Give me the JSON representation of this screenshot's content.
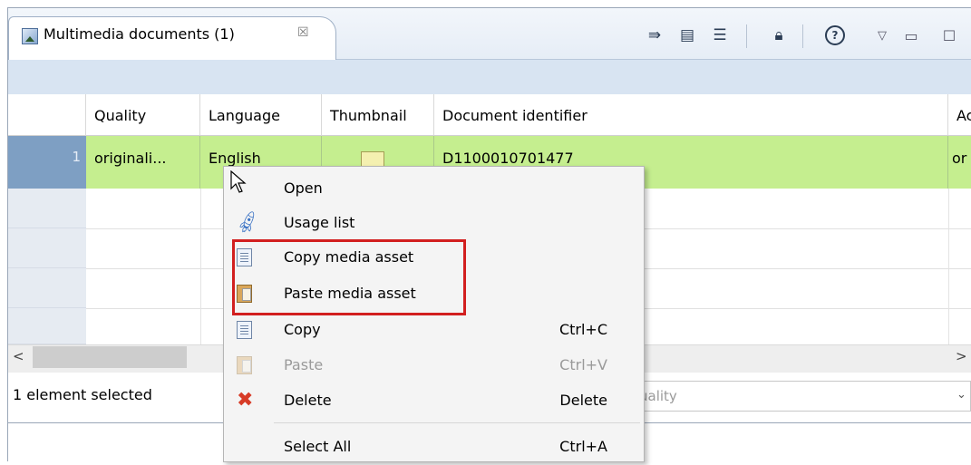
{
  "tab": {
    "title": "Multimedia documents (1)",
    "close_glyph": "☒"
  },
  "toolbar": {
    "icons": [
      "sync-icon",
      "layout-icon",
      "collapse-icon",
      "lock-icon",
      "help-icon",
      "view-menu-icon",
      "minimize-icon",
      "maximize-icon"
    ]
  },
  "table": {
    "columns": [
      "Quality",
      "Language",
      "Thumbnail",
      "Document identifier",
      "Ac"
    ],
    "rows": [
      {
        "num": "1",
        "quality": "originali...",
        "language": "English",
        "document_identifier": "D1100010701477",
        "ac": "or"
      }
    ]
  },
  "status": {
    "selection_text": "1 element selected"
  },
  "filter": {
    "quality_placeholder": "uality"
  },
  "context_menu": {
    "items": [
      {
        "label": "Open",
        "shortcut": "",
        "enabled": true,
        "icon": ""
      },
      {
        "label": "Usage list",
        "shortcut": "",
        "enabled": true,
        "icon": "rocket-icon"
      },
      {
        "label": "Copy media asset",
        "shortcut": "",
        "enabled": true,
        "icon": "copy-icon"
      },
      {
        "label": "Paste media asset",
        "shortcut": "",
        "enabled": true,
        "icon": "paste-icon"
      },
      {
        "label": "Copy",
        "shortcut": "Ctrl+C",
        "enabled": true,
        "icon": "copy-icon"
      },
      {
        "label": "Paste",
        "shortcut": "Ctrl+V",
        "enabled": false,
        "icon": "paste-icon"
      },
      {
        "label": "Delete",
        "shortcut": "Delete",
        "enabled": true,
        "icon": "delete-icon"
      },
      {
        "label": "Select All",
        "shortcut": "Ctrl+A",
        "enabled": true,
        "icon": ""
      }
    ]
  },
  "colors": {
    "selected_row": "#c5ee8f",
    "row_number_bg": "#7e9fc3",
    "highlight_box": "#d21f1f",
    "band": "#d8e4f2"
  }
}
